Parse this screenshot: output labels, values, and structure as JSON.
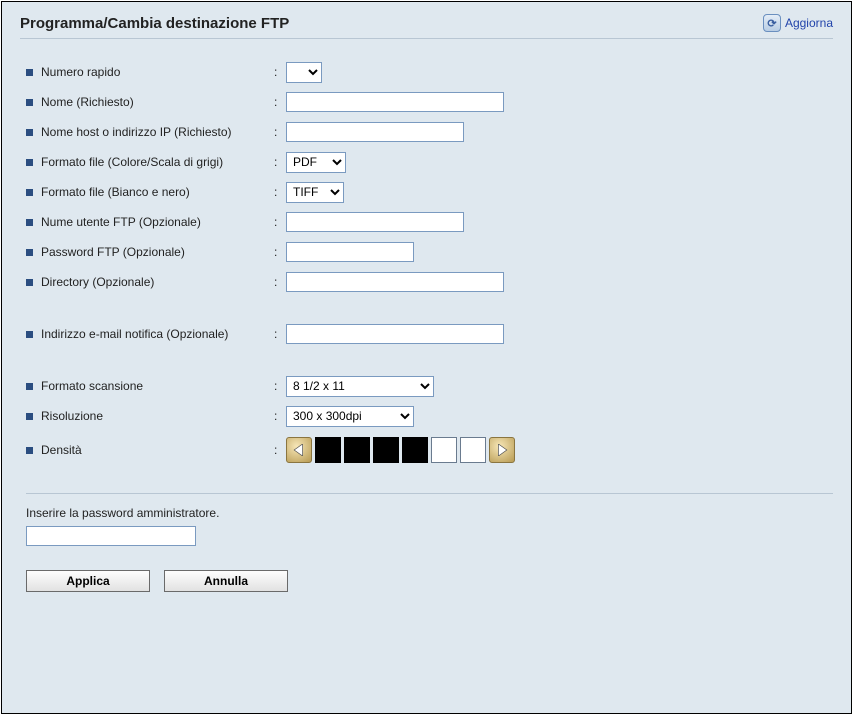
{
  "header": {
    "title": "Programma/Cambia destinazione FTP",
    "refresh": "Aggiorna"
  },
  "fields": {
    "quick_number_label": "Numero rapido",
    "name_label": "Nome (Richiesto)",
    "host_label": "Nome host o indirizzo IP (Richiesto)",
    "file_color_label": "Formato file (Colore/Scala di grigi)",
    "file_color_value": "PDF",
    "file_bw_label": "Formato file (Bianco e nero)",
    "file_bw_value": "TIFF",
    "ftp_user_label": "Nume utente FTP (Opzionale)",
    "ftp_pass_label": "Password FTP (Opzionale)",
    "directory_label": "Directory (Opzionale)",
    "notify_email_label": "Indirizzo e-mail notifica (Opzionale)",
    "scan_size_label": "Formato scansione",
    "scan_size_value": "8 1/2 x 11",
    "resolution_label": "Risoluzione",
    "resolution_value": "300 x 300dpi",
    "density_label": "Densità"
  },
  "density": {
    "cells": [
      true,
      true,
      true,
      true,
      false,
      false
    ]
  },
  "footer": {
    "admin_prompt": "Inserire la password amministratore.",
    "apply": "Applica",
    "cancel": "Annulla"
  }
}
